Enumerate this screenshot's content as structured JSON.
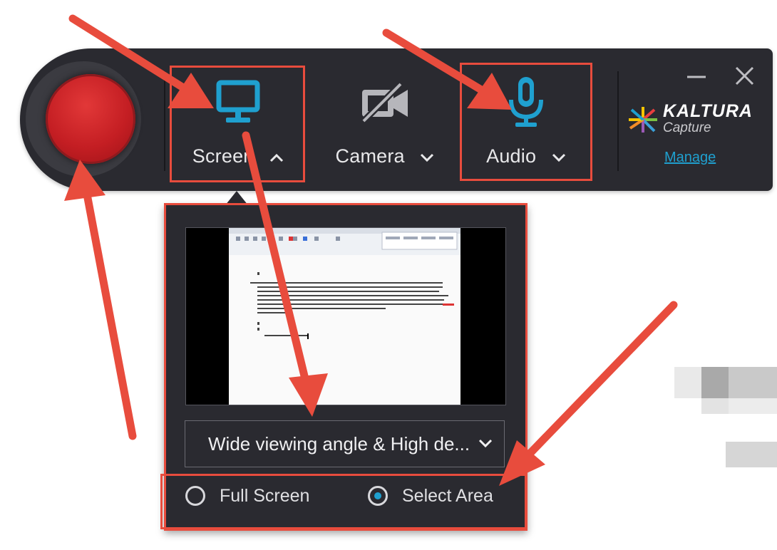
{
  "toolbar": {
    "screen": {
      "label": "Screen",
      "chevron": "chevron-up-icon",
      "color": "#1fa0cf"
    },
    "camera": {
      "label": "Camera",
      "chevron": "chevron-down-icon",
      "state": "disabled"
    },
    "audio": {
      "label": "Audio",
      "chevron": "chevron-down-icon",
      "color": "#1fa0cf"
    },
    "window_controls": {
      "minimize": "minimize-icon",
      "close": "close-icon"
    },
    "brand": {
      "name": "KALTURA",
      "product": "Capture",
      "manage_link": "Manage"
    }
  },
  "screen_panel": {
    "resolution_select": {
      "value": "Wide viewing angle & High de..."
    },
    "options": [
      {
        "label": "Full Screen",
        "selected": false
      },
      {
        "label": "Select Area",
        "selected": true
      }
    ]
  },
  "colors": {
    "accent": "#1fa0cf",
    "record": "#c41e23",
    "toolbar_bg": "#2a2a30",
    "annotation": "#e84c3d"
  }
}
